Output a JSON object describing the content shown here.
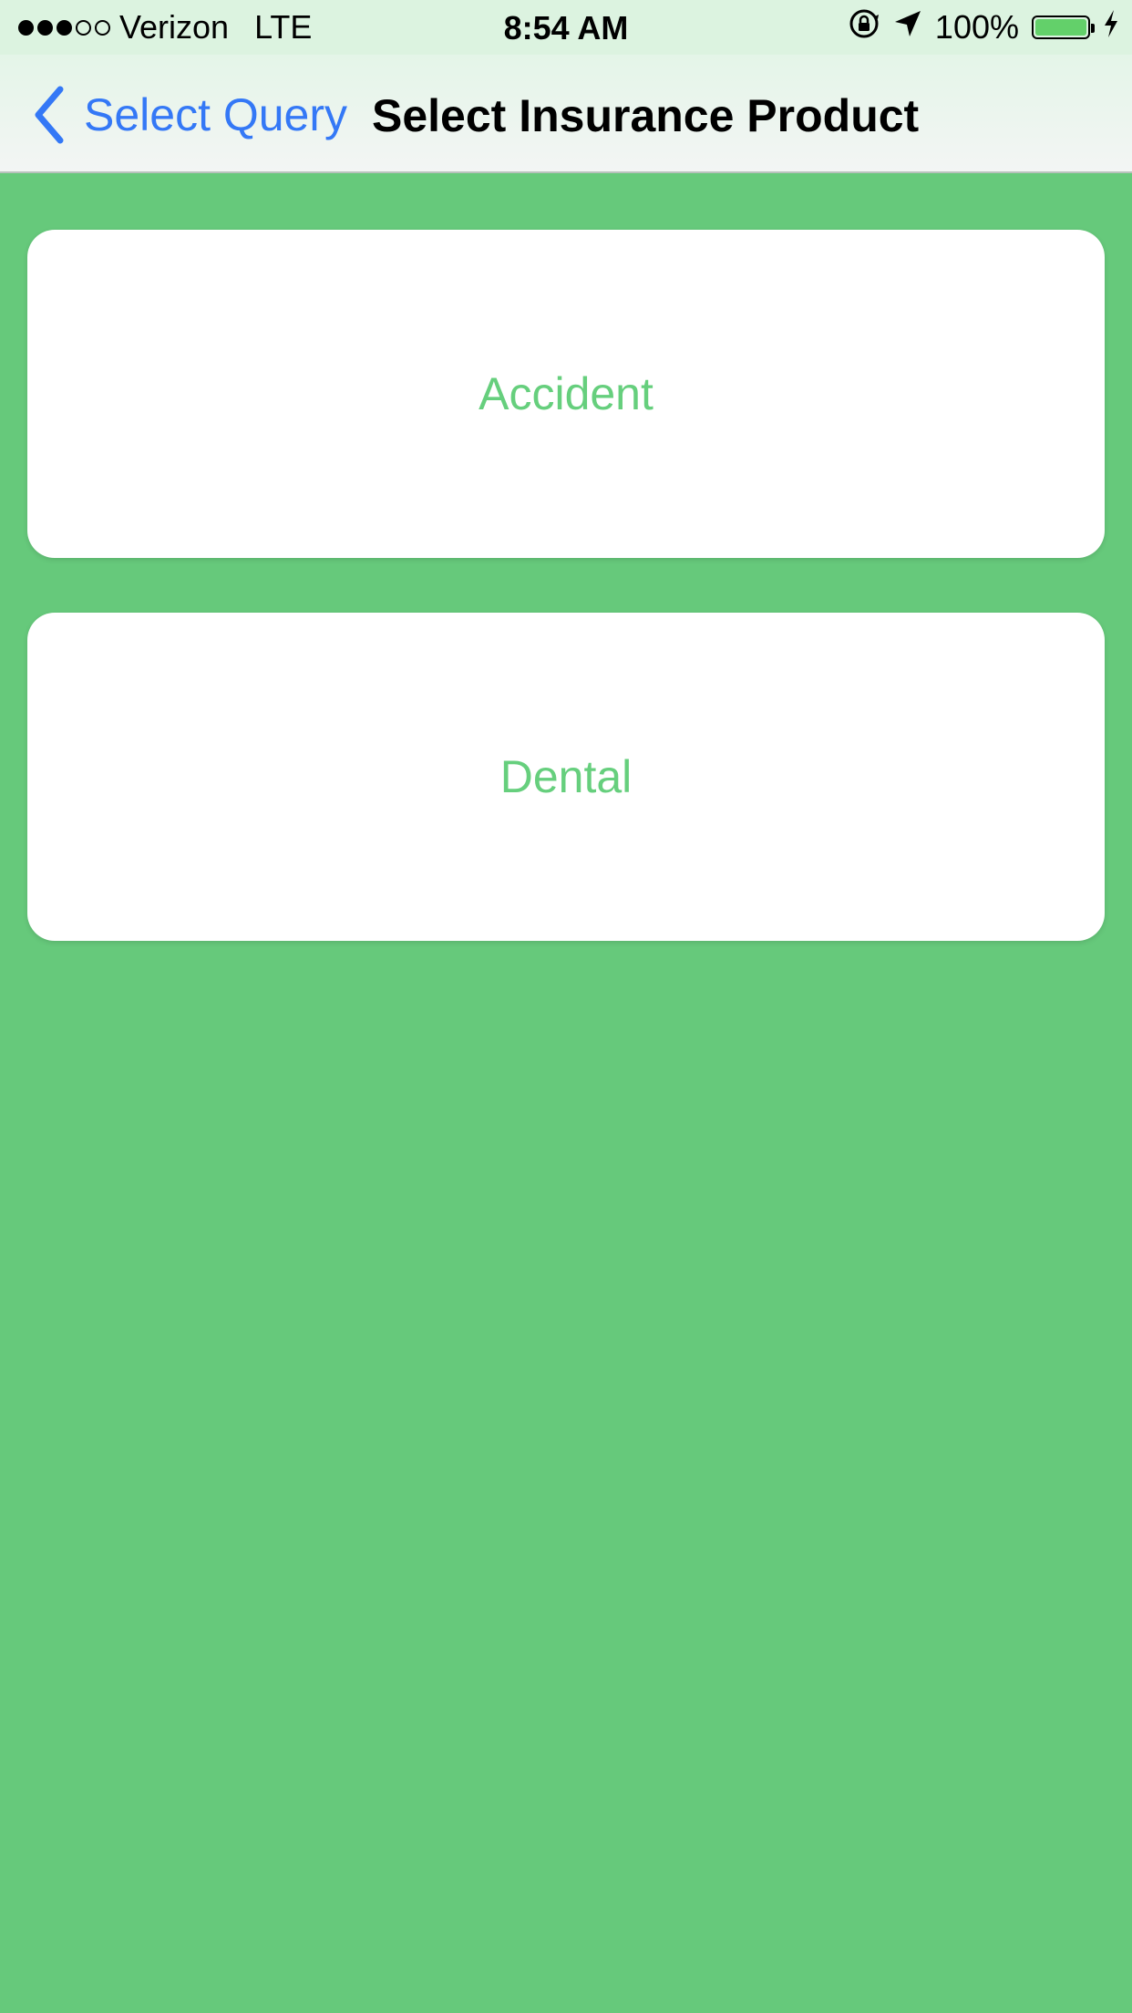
{
  "status_bar": {
    "signal_bars_filled": 3,
    "signal_bars_total": 5,
    "carrier": "Verizon",
    "network": "LTE",
    "time": "8:54 AM",
    "battery_percent": "100%",
    "icons": [
      "orientation-lock-icon",
      "location-arrow-icon",
      "battery-icon",
      "charging-bolt-icon"
    ]
  },
  "nav": {
    "back_label": "Select Query",
    "title": "Select Insurance Product"
  },
  "products": [
    {
      "label": "Accident"
    },
    {
      "label": "Dental"
    }
  ],
  "colors": {
    "background": "#66c97b",
    "card": "#ffffff",
    "card_text": "#66cf7d",
    "back_link": "#3478f6",
    "battery_fill": "#63d06a"
  }
}
